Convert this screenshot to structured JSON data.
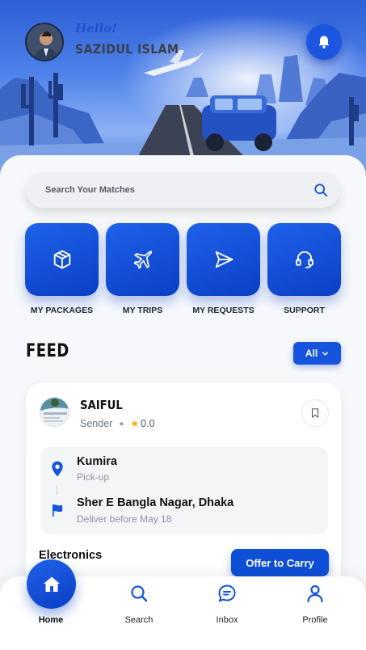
{
  "header": {
    "greeting": "Hello!",
    "user_name": "SAZIDUL ISLAM"
  },
  "search": {
    "placeholder": "Search Your Matches"
  },
  "quick_actions": [
    {
      "label": "MY PACKAGES",
      "icon": "package-icon"
    },
    {
      "label": "MY TRIPS",
      "icon": "airplane-icon"
    },
    {
      "label": "MY REQUESTS",
      "icon": "send-icon"
    },
    {
      "label": "SUPPORT",
      "icon": "headset-icon"
    }
  ],
  "feed": {
    "title": "FEED",
    "filter_label": "All",
    "card": {
      "name": "SAIFUL",
      "role": "Sender",
      "rating": "0.0",
      "pickup": {
        "place": "Kumira",
        "label": "Pick-up"
      },
      "dropoff": {
        "place": "Sher E Bangla Nagar, Dhaka",
        "label": "Deliver before May 18"
      },
      "category": "Electronics",
      "action_label": "Offer to Carry"
    }
  },
  "nav": {
    "items": [
      {
        "label": "Home",
        "icon": "home-icon"
      },
      {
        "label": "Search",
        "icon": "search-icon"
      },
      {
        "label": "Inbox",
        "icon": "chat-icon"
      },
      {
        "label": "Profile",
        "icon": "user-icon"
      }
    ]
  },
  "colors": {
    "primary": "#1654dd",
    "accent_star": "#f5b100"
  }
}
